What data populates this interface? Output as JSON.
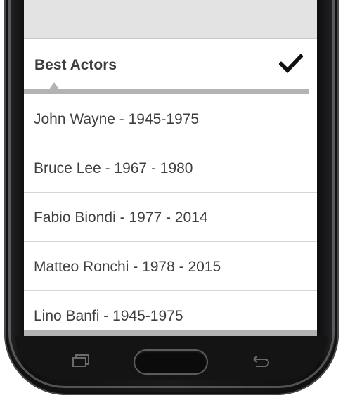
{
  "header": {
    "title": "Best Actors",
    "confirm_icon": "checkmark-icon"
  },
  "list": {
    "items": [
      {
        "label": "John Wayne - 1945-1975"
      },
      {
        "label": "Bruce Lee - 1967 - 1980"
      },
      {
        "label": "Fabio Biondi - 1977 - 2014"
      },
      {
        "label": "Matteo Ronchi - 1978 - 2015"
      },
      {
        "label": "Lino Banfi - 1945-1975"
      }
    ]
  },
  "device": {
    "nav_icons": [
      "recent-apps-icon",
      "home-button",
      "back-icon"
    ]
  },
  "colors": {
    "accent_bar": "#b3b3b3",
    "text": "#3f3f3f",
    "header_bg": "#e3e3e3"
  }
}
